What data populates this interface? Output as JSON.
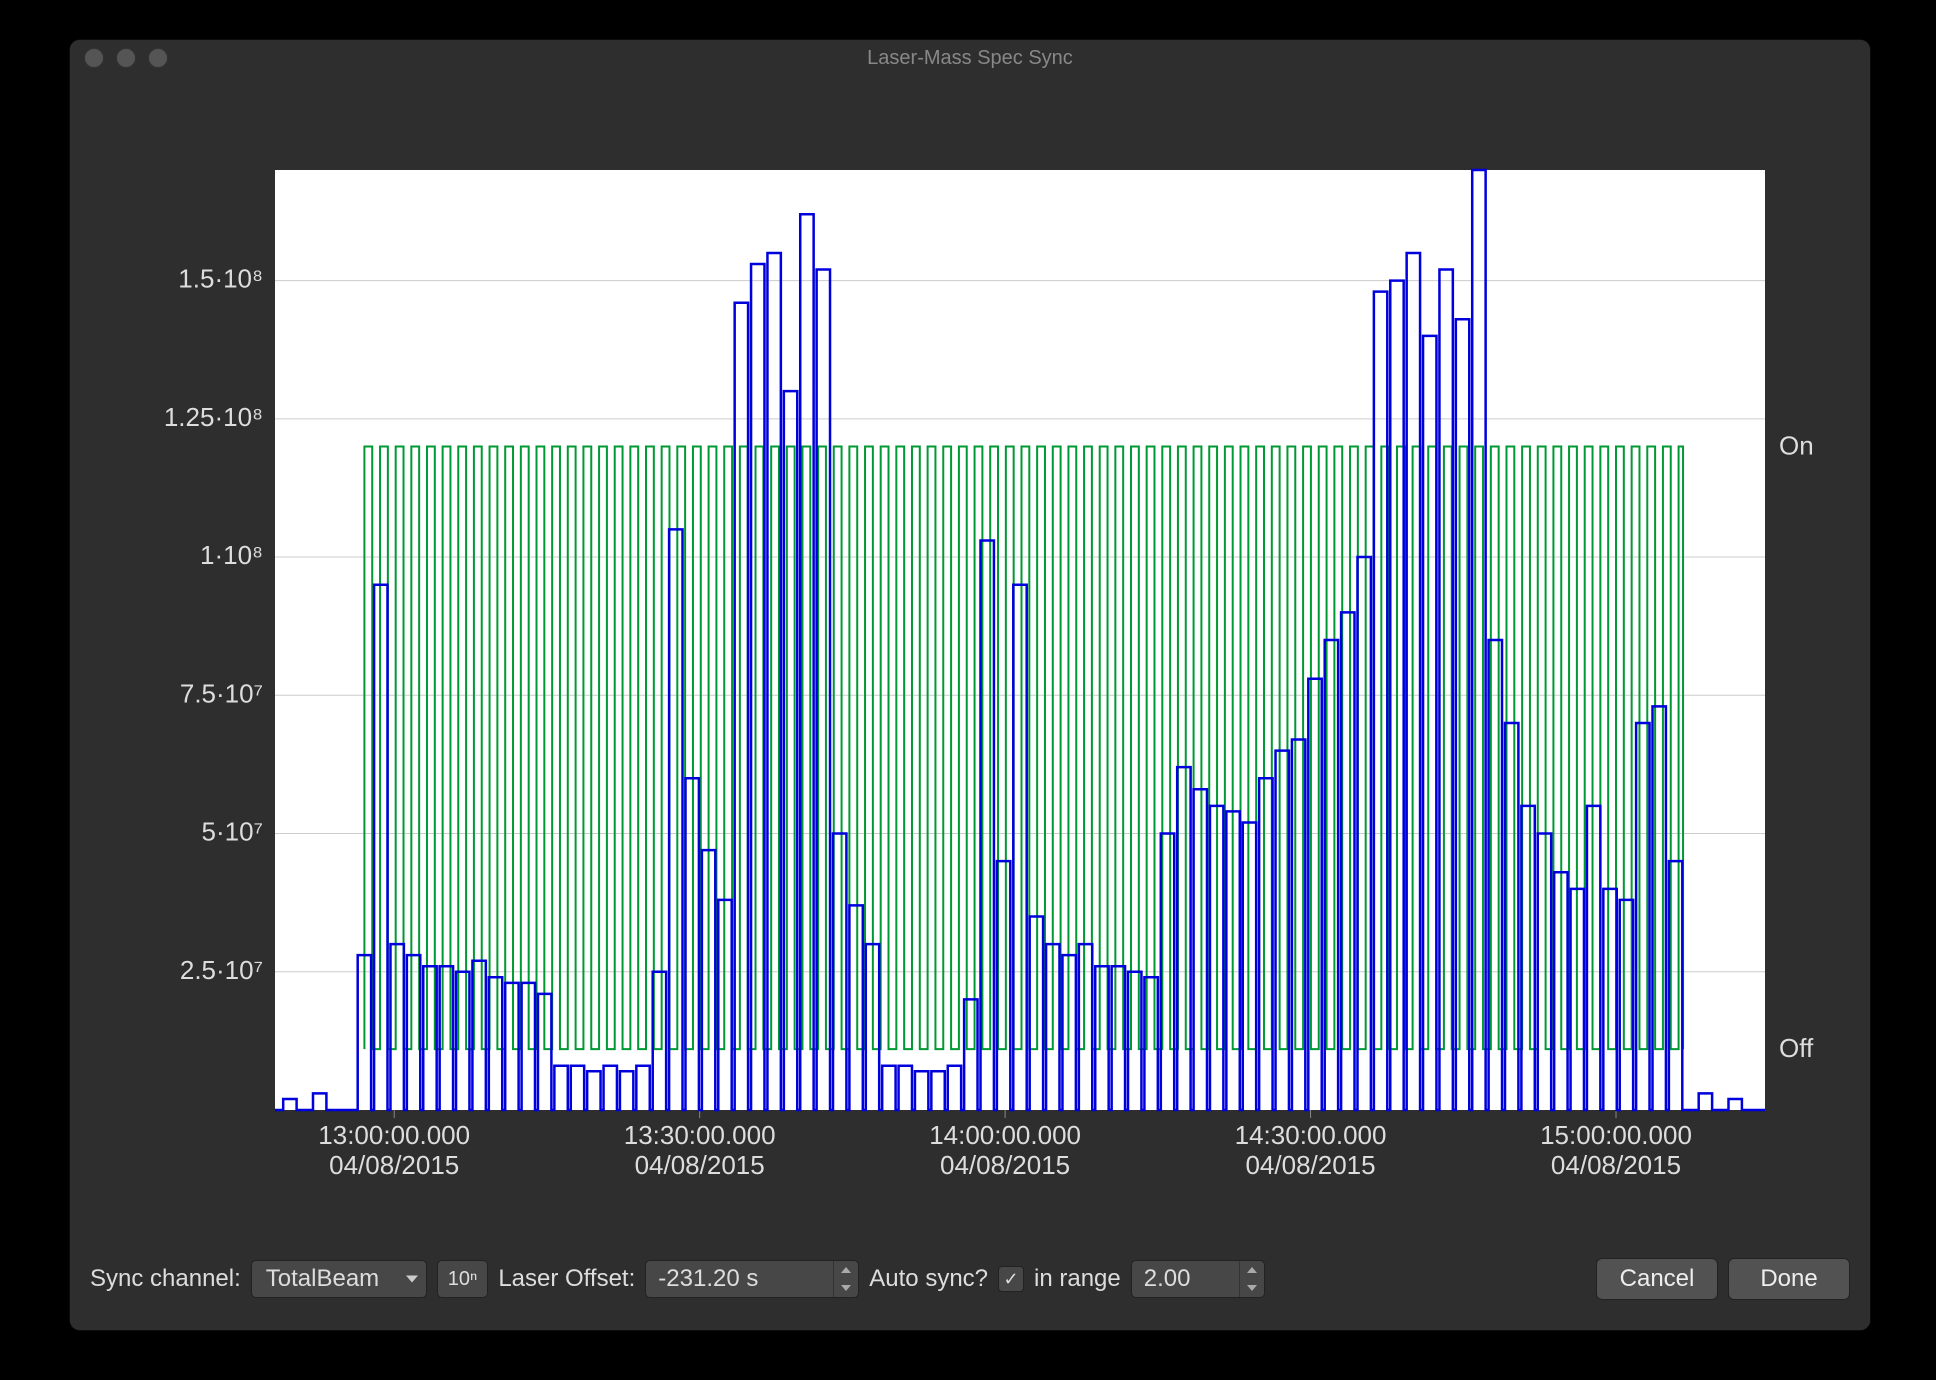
{
  "window": {
    "title": "Laser-Mass Spec Sync"
  },
  "toolbar": {
    "sync_channel_label": "Sync channel:",
    "sync_channel_value": "TotalBeam",
    "log_button": "10ⁿ",
    "laser_offset_label": "Laser Offset:",
    "laser_offset_value": "-231.20 s",
    "auto_sync_label": "Auto sync?",
    "auto_sync_checked": true,
    "in_range_label": "in range",
    "in_range_value": "2.00",
    "cancel": "Cancel",
    "done": "Done"
  },
  "chart_data": {
    "type": "line",
    "title": "",
    "xlabel": "",
    "ylabel": "",
    "left_axis": {
      "ticks": [
        "2.5·10⁷",
        "5·10⁷",
        "7.5·10⁷",
        "1·10⁸",
        "1.25·10⁸",
        "1.5·10⁸"
      ],
      "values": [
        25000000.0,
        50000000.0,
        75000000.0,
        100000000.0,
        125000000.0,
        150000000.0
      ],
      "range": [
        0,
        170000000.0
      ]
    },
    "right_axis": {
      "labels": [
        "Off",
        "On"
      ],
      "values": [
        11000000.0,
        120000000.0
      ]
    },
    "x_axis": {
      "ticks": [
        {
          "time": "13:00:00.000",
          "date": "04/08/2015",
          "x": 0.08
        },
        {
          "time": "13:30:00.000",
          "date": "04/08/2015",
          "x": 0.285
        },
        {
          "time": "14:00:00.000",
          "date": "04/08/2015",
          "x": 0.49
        },
        {
          "time": "14:30:00.000",
          "date": "04/08/2015",
          "x": 0.695
        },
        {
          "time": "15:00:00.000",
          "date": "04/08/2015",
          "x": 0.9
        }
      ],
      "range": [
        "12:50",
        "15:15"
      ]
    },
    "series": [
      {
        "name": "Laser",
        "type": "square-pulse",
        "color": "#009933",
        "period": 0.0105,
        "duty": 0.5,
        "start_x": 0.06,
        "end_x": 0.945,
        "low_val": 11000000.0,
        "high_val": 120000000.0
      },
      {
        "name": "TotalBeam",
        "type": "pulse-train",
        "color": "#0000dd",
        "baseline": 0,
        "peaks": [
          {
            "x": 0.01,
            "v": 2000000.0
          },
          {
            "x": 0.03,
            "v": 3000000.0
          },
          {
            "x": 0.06,
            "v": 28000000.0
          },
          {
            "x": 0.071,
            "v": 95000000.0
          },
          {
            "x": 0.082,
            "v": 30000000.0
          },
          {
            "x": 0.093,
            "v": 28000000.0
          },
          {
            "x": 0.104,
            "v": 26000000.0
          },
          {
            "x": 0.115,
            "v": 26000000.0
          },
          {
            "x": 0.126,
            "v": 25000000.0
          },
          {
            "x": 0.137,
            "v": 27000000.0
          },
          {
            "x": 0.148,
            "v": 24000000.0
          },
          {
            "x": 0.159,
            "v": 23000000.0
          },
          {
            "x": 0.17,
            "v": 23000000.0
          },
          {
            "x": 0.181,
            "v": 21000000.0
          },
          {
            "x": 0.192,
            "v": 8000000.0
          },
          {
            "x": 0.203,
            "v": 8000000.0
          },
          {
            "x": 0.214,
            "v": 7000000.0
          },
          {
            "x": 0.225,
            "v": 8000000.0
          },
          {
            "x": 0.236,
            "v": 7000000.0
          },
          {
            "x": 0.247,
            "v": 8000000.0
          },
          {
            "x": 0.258,
            "v": 25000000.0
          },
          {
            "x": 0.269,
            "v": 105000000.0
          },
          {
            "x": 0.28,
            "v": 60000000.0
          },
          {
            "x": 0.291,
            "v": 47000000.0
          },
          {
            "x": 0.302,
            "v": 38000000.0
          },
          {
            "x": 0.313,
            "v": 146000000.0
          },
          {
            "x": 0.324,
            "v": 153000000.0
          },
          {
            "x": 0.335,
            "v": 155000000.0
          },
          {
            "x": 0.346,
            "v": 130000000.0
          },
          {
            "x": 0.357,
            "v": 162000000.0
          },
          {
            "x": 0.368,
            "v": 152000000.0
          },
          {
            "x": 0.379,
            "v": 50000000.0
          },
          {
            "x": 0.39,
            "v": 37000000.0
          },
          {
            "x": 0.401,
            "v": 30000000.0
          },
          {
            "x": 0.412,
            "v": 8000000.0
          },
          {
            "x": 0.423,
            "v": 8000000.0
          },
          {
            "x": 0.434,
            "v": 7000000.0
          },
          {
            "x": 0.445,
            "v": 7000000.0
          },
          {
            "x": 0.456,
            "v": 8000000.0
          },
          {
            "x": 0.467,
            "v": 20000000.0
          },
          {
            "x": 0.478,
            "v": 103000000.0
          },
          {
            "x": 0.489,
            "v": 45000000.0
          },
          {
            "x": 0.5,
            "v": 95000000.0
          },
          {
            "x": 0.511,
            "v": 35000000.0
          },
          {
            "x": 0.522,
            "v": 30000000.0
          },
          {
            "x": 0.533,
            "v": 28000000.0
          },
          {
            "x": 0.544,
            "v": 30000000.0
          },
          {
            "x": 0.555,
            "v": 26000000.0
          },
          {
            "x": 0.566,
            "v": 26000000.0
          },
          {
            "x": 0.577,
            "v": 25000000.0
          },
          {
            "x": 0.588,
            "v": 24000000.0
          },
          {
            "x": 0.599,
            "v": 50000000.0
          },
          {
            "x": 0.61,
            "v": 62000000.0
          },
          {
            "x": 0.621,
            "v": 58000000.0
          },
          {
            "x": 0.632,
            "v": 55000000.0
          },
          {
            "x": 0.643,
            "v": 54000000.0
          },
          {
            "x": 0.654,
            "v": 52000000.0
          },
          {
            "x": 0.665,
            "v": 60000000.0
          },
          {
            "x": 0.676,
            "v": 65000000.0
          },
          {
            "x": 0.687,
            "v": 67000000.0
          },
          {
            "x": 0.698,
            "v": 78000000.0
          },
          {
            "x": 0.709,
            "v": 85000000.0
          },
          {
            "x": 0.72,
            "v": 90000000.0
          },
          {
            "x": 0.731,
            "v": 100000000.0
          },
          {
            "x": 0.742,
            "v": 148000000.0
          },
          {
            "x": 0.753,
            "v": 150000000.0
          },
          {
            "x": 0.764,
            "v": 155000000.0
          },
          {
            "x": 0.775,
            "v": 140000000.0
          },
          {
            "x": 0.786,
            "v": 152000000.0
          },
          {
            "x": 0.797,
            "v": 143000000.0
          },
          {
            "x": 0.808,
            "v": 170000000.0
          },
          {
            "x": 0.819,
            "v": 85000000.0
          },
          {
            "x": 0.83,
            "v": 70000000.0
          },
          {
            "x": 0.841,
            "v": 55000000.0
          },
          {
            "x": 0.852,
            "v": 50000000.0
          },
          {
            "x": 0.863,
            "v": 43000000.0
          },
          {
            "x": 0.874,
            "v": 40000000.0
          },
          {
            "x": 0.885,
            "v": 55000000.0
          },
          {
            "x": 0.896,
            "v": 40000000.0
          },
          {
            "x": 0.907,
            "v": 38000000.0
          },
          {
            "x": 0.918,
            "v": 70000000.0
          },
          {
            "x": 0.929,
            "v": 73000000.0
          },
          {
            "x": 0.94,
            "v": 45000000.0
          },
          {
            "x": 0.96,
            "v": 3000000.0
          },
          {
            "x": 0.98,
            "v": 2000000.0
          }
        ]
      }
    ]
  }
}
